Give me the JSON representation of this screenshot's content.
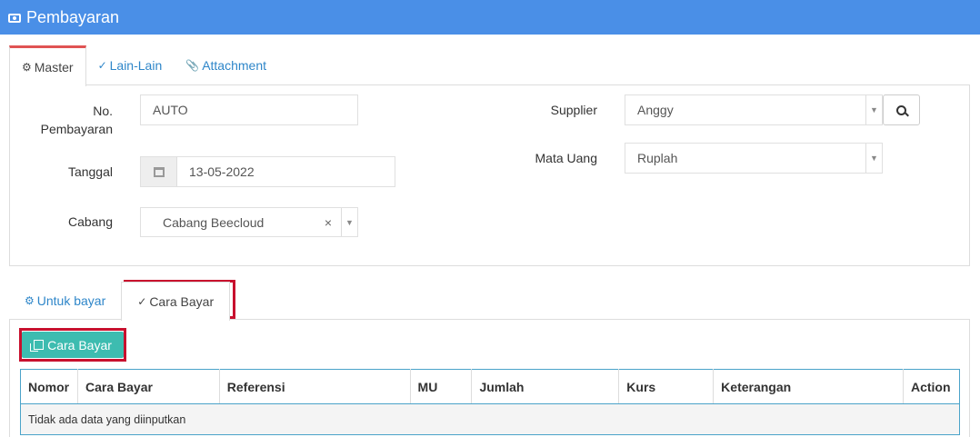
{
  "title": "Pembayaran",
  "tabs_top": [
    {
      "label": "Master",
      "icon": "gears-icon"
    },
    {
      "label": "Lain-Lain",
      "icon": "check-circle-icon"
    },
    {
      "label": "Attachment",
      "icon": "paperclip-icon"
    }
  ],
  "form": {
    "no_pembayaran_label": "No. Pembayaran",
    "no_pembayaran_value": "AUTO",
    "tanggal_label": "Tanggal",
    "tanggal_value": "13-05-2022",
    "cabang_label": "Cabang",
    "cabang_value": "Cabang Beecloud",
    "supplier_label": "Supplier",
    "supplier_value": "Anggy",
    "mata_uang_label": "Mata Uang",
    "mata_uang_value": "Ruplah"
  },
  "tabs_bottom": [
    {
      "label": "Untuk bayar",
      "icon": "gears-icon"
    },
    {
      "label": "Cara Bayar",
      "icon": "check-circle-icon"
    }
  ],
  "cara_bayar_button": "Cara Bayar",
  "table": {
    "columns": [
      "Nomor",
      "Cara Bayar",
      "Referensi",
      "MU",
      "Jumlah",
      "Kurs",
      "Keterangan",
      "Action"
    ],
    "empty_text": "Tidak ada data yang diinputkan"
  },
  "colors": {
    "titlebar": "#4a8fe7",
    "accent_tab": "#e05353",
    "button_teal": "#3dbcb0",
    "highlight_red": "#c8102e",
    "link_blue": "#2e86c9"
  }
}
